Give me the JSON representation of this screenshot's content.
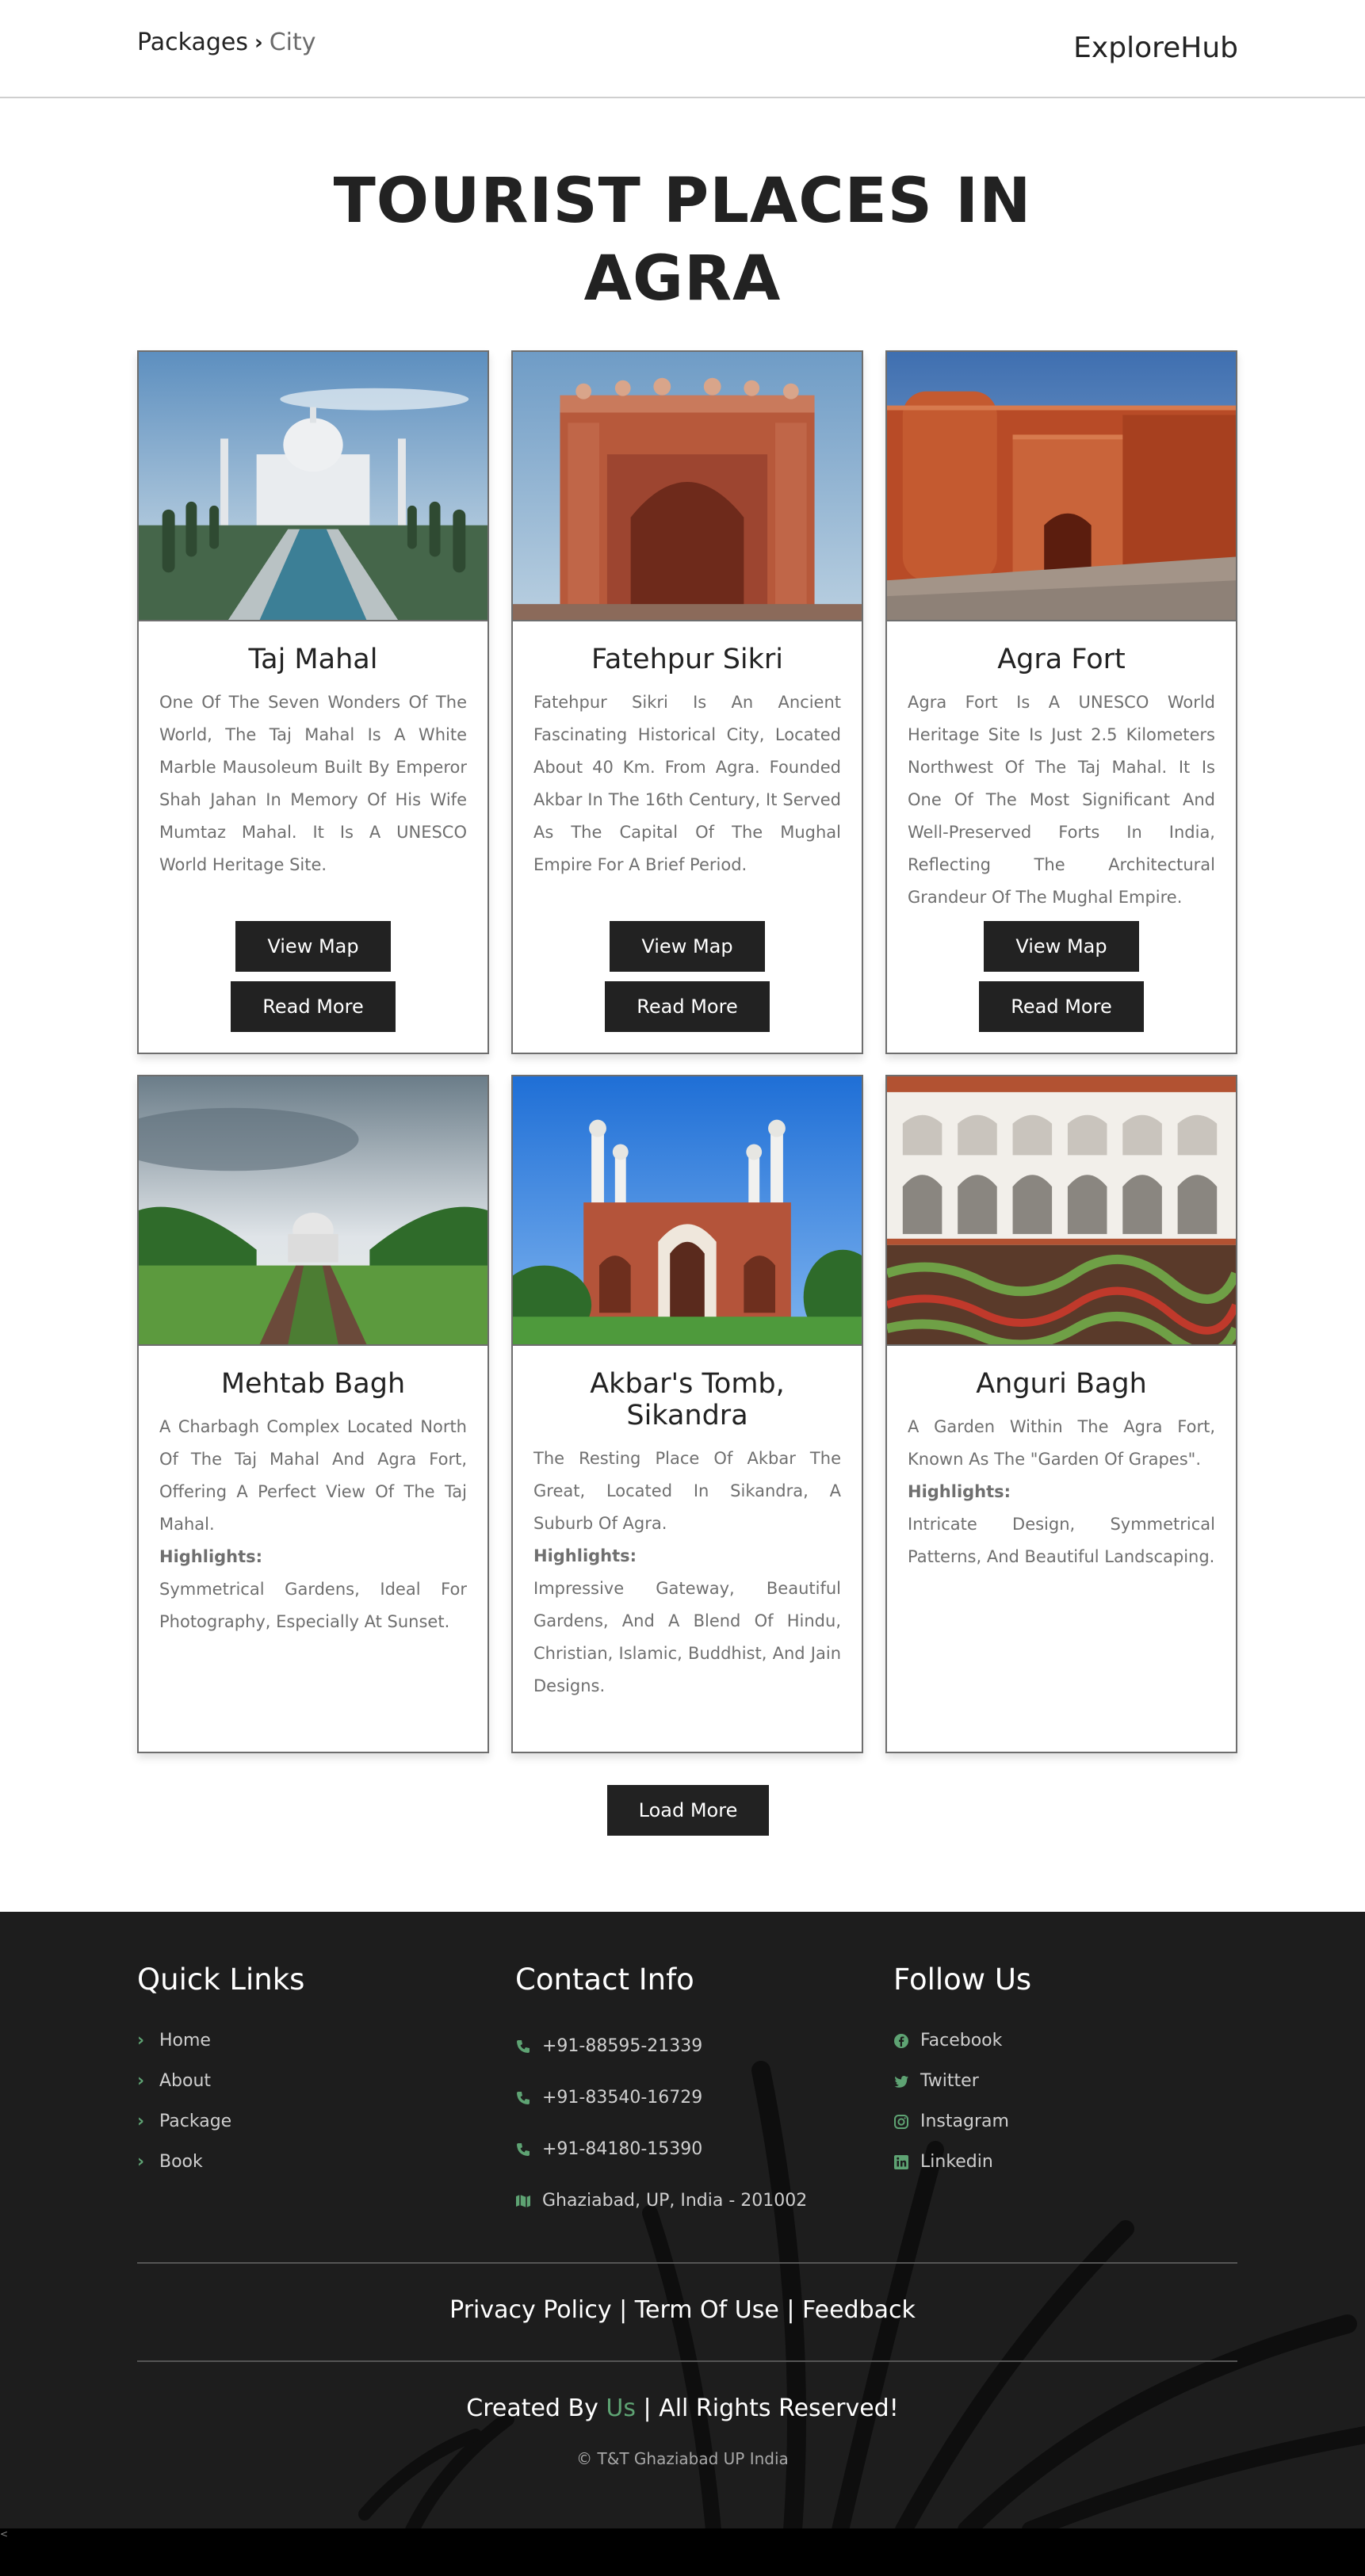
{
  "header": {
    "breadcrumb_root": "Packages",
    "breadcrumb_sep": "›",
    "breadcrumb_current": "City",
    "brand": "ExploreHub"
  },
  "title": {
    "line1": "TOURIST PLACES IN",
    "line2": "AGRA"
  },
  "cards": [
    {
      "name": "Taj Mahal",
      "desc": "One Of The Seven Wonders Of The World, The Taj Mahal Is A White Marble Mausoleum Built By Emperor Shah Jahan In Memory Of His Wife Mumtaz Mahal. It Is A UNESCO World Heritage Site.",
      "map_label": "View Map",
      "more_label": "Read More"
    },
    {
      "name": "Fatehpur Sikri",
      "desc": "Fatehpur Sikri Is An Ancient Fascinating Historical City, Located About 40 Km. From Agra. Founded Akbar In The 16th Century, It Served As The Capital Of The Mughal Empire For A Brief Period.",
      "map_label": "View Map",
      "more_label": "Read More"
    },
    {
      "name": "Agra Fort",
      "desc": "Agra Fort Is A UNESCO World Heritage Site Is Just 2.5 Kilometers Northwest Of The Taj Mahal. It Is One Of The Most Significant And Well-Preserved Forts In India, Reflecting The Architectural Grandeur Of The Mughal Empire.",
      "map_label": "View Map",
      "more_label": "Read More"
    },
    {
      "name": "Mehtab Bagh",
      "desc": "A Charbagh Complex Located North Of The Taj Mahal And Agra Fort, Offering A Perfect View Of The Taj Mahal.",
      "highlights_label": "Highlights:",
      "highlights": "Symmetrical Gardens, Ideal For Photography, Especially At Sunset."
    },
    {
      "name": "Akbar's Tomb, Sikandra",
      "desc": "The Resting Place Of Akbar The Great, Located In Sikandra, A Suburb Of Agra.",
      "highlights_label": "Highlights:",
      "highlights": "Impressive Gateway, Beautiful Gardens, And A Blend Of Hindu, Christian, Islamic, Buddhist, And Jain Designs."
    },
    {
      "name": "Anguri Bagh",
      "desc": "A Garden Within The Agra Fort, Known As The \"Garden Of Grapes\".",
      "highlights_label": "Highlights:",
      "highlights": "Intricate Design, Symmetrical Patterns, And Beautiful Landscaping."
    }
  ],
  "load_more": "Load More",
  "footer": {
    "quick_links": {
      "heading": "Quick Links",
      "items": [
        "Home",
        "About",
        "Package",
        "Book"
      ]
    },
    "contact": {
      "heading": "Contact Info",
      "phones": [
        "+91-88595-21339",
        "+91-83540-16729",
        "+91-84180-15390"
      ],
      "address": "Ghaziabad, UP, India - 201002"
    },
    "follow": {
      "heading": "Follow Us",
      "items": [
        "Facebook",
        "Twitter",
        "Instagram",
        "Linkedin"
      ]
    },
    "links": {
      "privacy": "Privacy Policy",
      "sep": "|",
      "terms": "Term Of Use",
      "feedback": "Feedback"
    },
    "credit": {
      "prefix": "Created By",
      "us": "Us",
      "suffix": "| All Rights Reserved!"
    },
    "copyright": "© T&T Ghaziabad UP India",
    "accent": "#5ea373"
  },
  "corner_mark": "<"
}
